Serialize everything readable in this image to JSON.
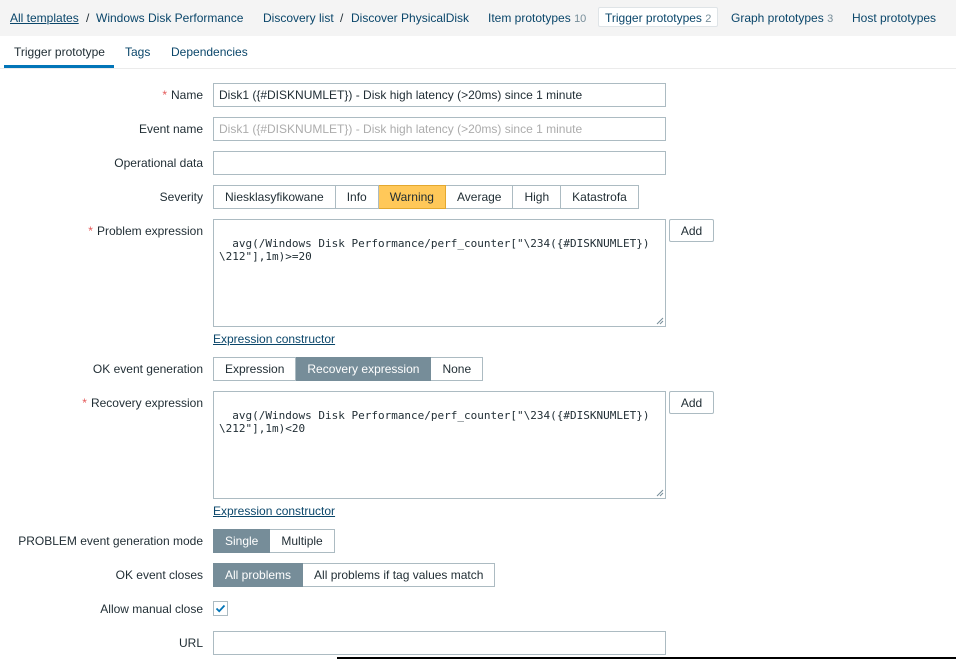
{
  "breadcrumbs": {
    "all_templates": "All templates",
    "template": "Windows Disk Performance",
    "discovery_list": "Discovery list",
    "discovery_rule": "Discover PhysicalDisk",
    "item_prototypes": "Item prototypes",
    "item_prototypes_count": "10",
    "trigger_prototypes": "Trigger prototypes",
    "trigger_prototypes_count": "2",
    "graph_prototypes": "Graph prototypes",
    "graph_prototypes_count": "3",
    "host_prototypes": "Host prototypes"
  },
  "tabs": [
    "Trigger prototype",
    "Tags",
    "Dependencies"
  ],
  "form": {
    "name_label": "Name",
    "name_value": "Disk1 ({#DISKNUMLET}) - Disk high latency (>20ms) since 1 minute",
    "event_name_label": "Event name",
    "event_name_placeholder": "Disk1 ({#DISKNUMLET}) - Disk high latency (>20ms) since 1 minute",
    "operational_data_label": "Operational data",
    "operational_data_value": "",
    "severity_label": "Severity",
    "severity_options": [
      "Niesklasyfikowane",
      "Info",
      "Warning",
      "Average",
      "High",
      "Katastrofa"
    ],
    "severity_selected": "Warning",
    "problem_expression_label": "Problem expression",
    "problem_expression_value": "avg(/Windows Disk Performance/perf_counter[\"\\234({#DISKNUMLET})\\212\"],1m)>=20",
    "add_label": "Add",
    "expression_constructor": "Expression constructor",
    "ok_event_generation_label": "OK event generation",
    "ok_event_generation_options": [
      "Expression",
      "Recovery expression",
      "None"
    ],
    "ok_event_generation_selected": "Recovery expression",
    "recovery_expression_label": "Recovery expression",
    "recovery_expression_value": "avg(/Windows Disk Performance/perf_counter[\"\\234({#DISKNUMLET})\\212\"],1m)<20",
    "problem_mode_label": "PROBLEM event generation mode",
    "problem_mode_options": [
      "Single",
      "Multiple"
    ],
    "problem_mode_selected": "Single",
    "ok_event_closes_label": "OK event closes",
    "ok_event_closes_options": [
      "All problems",
      "All problems if tag values match"
    ],
    "ok_event_closes_selected": "All problems",
    "allow_manual_close_label": "Allow manual close",
    "allow_manual_close_checked": true,
    "url_label": "URL",
    "url_value": ""
  },
  "colors": {
    "link": "#0a466a",
    "active_tab_underline": "#0275b8",
    "warning": "#ffc859",
    "selected_segment": "#768d99",
    "required_asterisk": "#e45959"
  },
  "icons": {
    "checkbox": "checkmark-icon",
    "resize": "resize-handle-icon"
  }
}
